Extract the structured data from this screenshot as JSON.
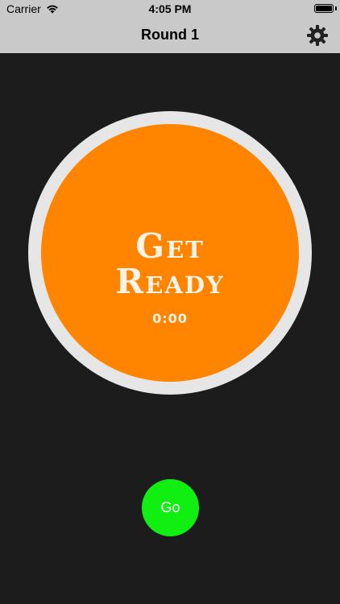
{
  "status_bar": {
    "carrier": "Carrier",
    "time": "4:05 PM",
    "battery_level": 1.0
  },
  "nav": {
    "title": "Round 1",
    "settings_icon": "gear-icon"
  },
  "timer_ring": {
    "line1": "Get",
    "line2": "Ready",
    "time": "0:00",
    "ring_color": "#e6e6e6",
    "fill_color": "#ff8400"
  },
  "go_button": {
    "label": "Go",
    "color": "#11ee11"
  },
  "colors": {
    "background": "#1c1c1c",
    "bar": "#c9c9c9"
  }
}
